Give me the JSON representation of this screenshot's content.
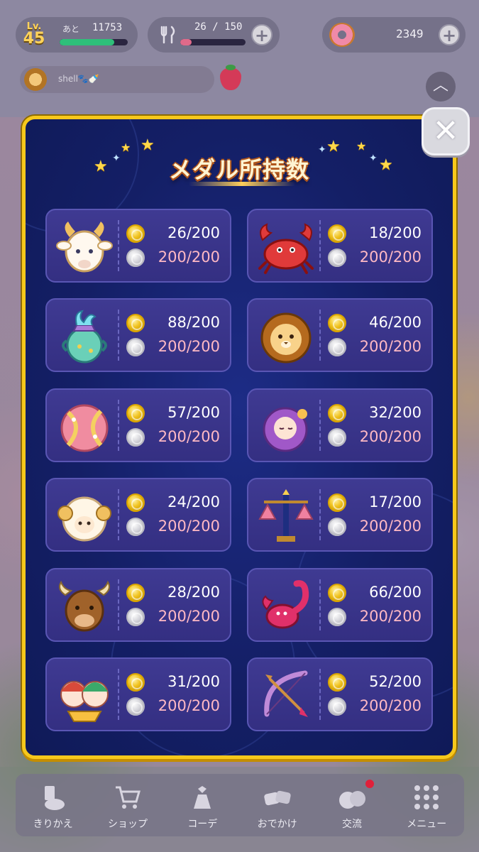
{
  "hud": {
    "level_label": "Lv.",
    "level": "45",
    "exp_prefix": "あと",
    "exp_remaining": "11753",
    "exp_progress": 0.8,
    "stamina": "26 / 150",
    "stamina_progress": 0.17,
    "donuts": "2349",
    "plus": "+",
    "player_name": "shell🐾🍼",
    "up_arrow": "︿"
  },
  "modal": {
    "title": "メダル所持数",
    "close": "✕",
    "medals": [
      {
        "sign": "goat-icon",
        "gold": "26/200",
        "silver": "200/200"
      },
      {
        "sign": "crab-icon",
        "gold": "18/200",
        "silver": "200/200"
      },
      {
        "sign": "water-bearer-icon",
        "gold": "88/200",
        "silver": "200/200"
      },
      {
        "sign": "lion-icon",
        "gold": "46/200",
        "silver": "200/200"
      },
      {
        "sign": "fish-icon",
        "gold": "57/200",
        "silver": "200/200"
      },
      {
        "sign": "maiden-icon",
        "gold": "32/200",
        "silver": "200/200"
      },
      {
        "sign": "ram-icon",
        "gold": "24/200",
        "silver": "200/200"
      },
      {
        "sign": "scales-icon",
        "gold": "17/200",
        "silver": "200/200"
      },
      {
        "sign": "bull-icon",
        "gold": "28/200",
        "silver": "200/200"
      },
      {
        "sign": "scorpion-icon",
        "gold": "66/200",
        "silver": "200/200"
      },
      {
        "sign": "twins-icon",
        "gold": "31/200",
        "silver": "200/200"
      },
      {
        "sign": "bow-icon",
        "gold": "52/200",
        "silver": "200/200"
      }
    ]
  },
  "nav": [
    {
      "label": "きりかえ",
      "icon": "switch-icon"
    },
    {
      "label": "ショップ",
      "icon": "cart-icon"
    },
    {
      "label": "コーデ",
      "icon": "outfit-icon"
    },
    {
      "label": "おでかけ",
      "icon": "outing-icon"
    },
    {
      "label": "交流",
      "icon": "friends-icon"
    },
    {
      "label": "メニュー",
      "icon": "menu-grid-icon"
    }
  ],
  "colors": {
    "modal_bg": "#141f66",
    "modal_border": "#f7c81b",
    "card_bg": "#3f3a92",
    "silver_text": "#ffb9c4",
    "exp_bar": "#2fbf7a",
    "stamina_bar": "#e06a8a"
  }
}
